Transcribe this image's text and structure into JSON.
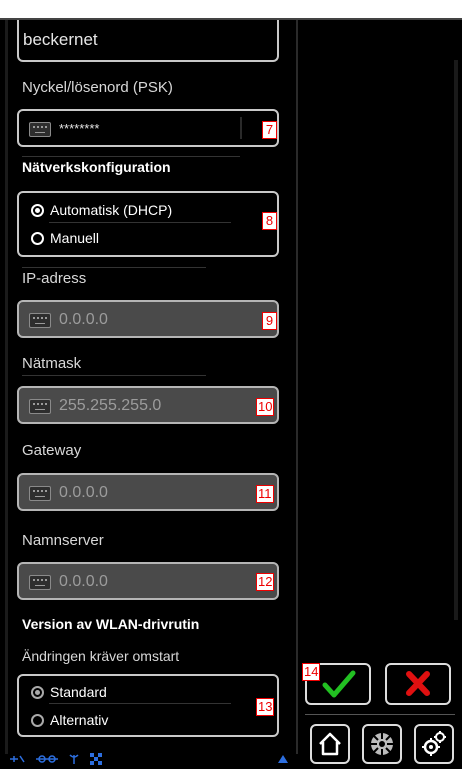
{
  "network": {
    "ssid_value": "beckernet",
    "psk_label": "Nyckel/lösenord (PSK)",
    "psk_value": "********",
    "psk_badge": "7",
    "config_label": "Nätverkskonfiguration",
    "config_options": [
      "Automatisk (DHCP)",
      "Manuell"
    ],
    "config_selected": "Automatisk (DHCP)",
    "config_badge": "8",
    "ip_label": "IP-adress",
    "ip_value": "0.0.0.0",
    "ip_badge": "9",
    "mask_label": "Nätmask",
    "mask_value": "255.255.255.0",
    "mask_badge": "10",
    "gateway_label": "Gateway",
    "gateway_value": "0.0.0.0",
    "gateway_badge": "11",
    "dns_label": "Namnserver",
    "dns_value": "0.0.0.0",
    "dns_badge": "12"
  },
  "driver": {
    "title": "Version av WLAN-drivrutin",
    "note": "Ändringen kräver omstart",
    "options": [
      "Standard",
      "Alternativ"
    ],
    "selected": "Standard",
    "badge": "13"
  },
  "actions": {
    "confirm_badge": "14",
    "confirm_icon": "check-icon",
    "cancel_icon": "close-icon",
    "home_icon": "home-icon",
    "media_icon": "reel-icon",
    "settings_icon": "gears-icon",
    "confirm_color": "#22c022",
    "cancel_color": "#e01010"
  },
  "colors": {
    "background": "#000000",
    "badge_border": "#e00000",
    "status_icon": "#2d6fe0"
  }
}
